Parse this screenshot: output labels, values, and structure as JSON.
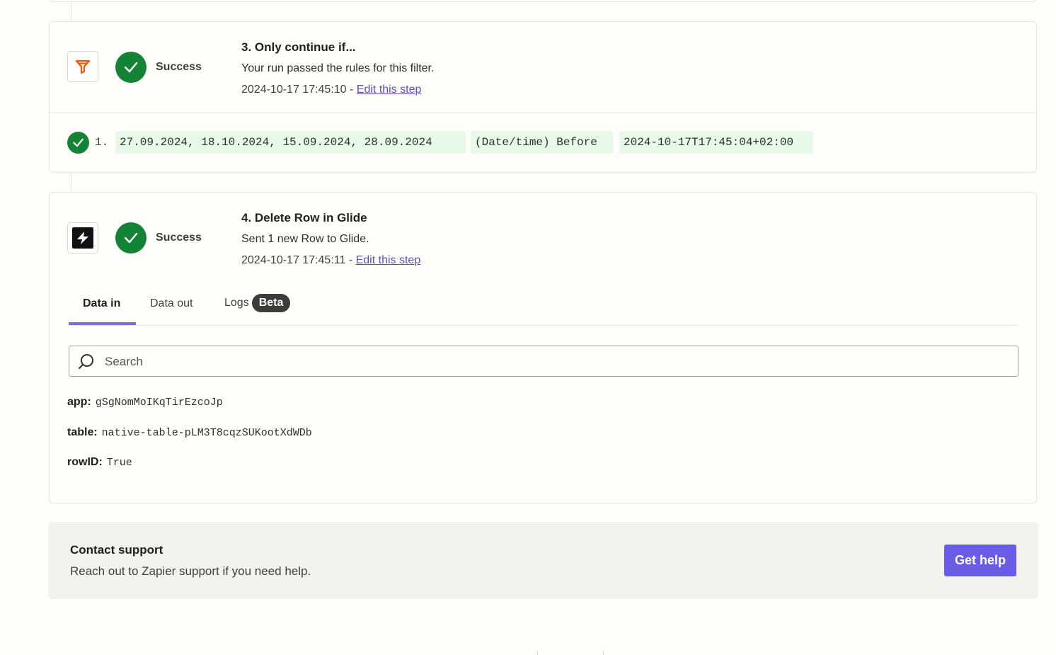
{
  "steps": [
    {
      "title": "3. Only continue if...",
      "status": "Success",
      "description": "Your run passed the rules for this filter.",
      "timestamp": "2024-10-17 17:45:10",
      "separator": " - ",
      "edit_link": "Edit this step",
      "app_icon": "filter-icon",
      "rule": {
        "index": "1.",
        "values": "27.09.2024, 18.10.2024, 15.09.2024, 28.09.2024",
        "operator": "(Date/time) Before",
        "compare": "2024-10-17T17:45:04+02:00"
      }
    },
    {
      "title": "4. Delete Row in Glide",
      "status": "Success",
      "description": "Sent 1 new Row to Glide.",
      "timestamp": "2024-10-17 17:45:11",
      "separator": " - ",
      "edit_link": "Edit this step",
      "app_icon": "glide-icon",
      "tabs": [
        {
          "label": "Data in",
          "active": true
        },
        {
          "label": "Data out",
          "active": false
        },
        {
          "label": "Logs",
          "active": false,
          "badge": "Beta"
        }
      ],
      "search": {
        "placeholder": "Search"
      },
      "fields": [
        {
          "key": "app:",
          "value": "gSgNomMoIKqTirEzcoJp"
        },
        {
          "key": "table:",
          "value": "native-table-pLM3T8cqzSUKootXdWDb"
        },
        {
          "key": "rowID:",
          "value": "True"
        }
      ]
    }
  ],
  "support": {
    "title": "Contact support",
    "description": "Reach out to Zapier support if you need help.",
    "button_label": "Get help"
  },
  "colors": {
    "success": "#138435",
    "accent": "#6b5ce7",
    "link": "#5d4dc6",
    "filter_icon": "#ff4f00"
  }
}
